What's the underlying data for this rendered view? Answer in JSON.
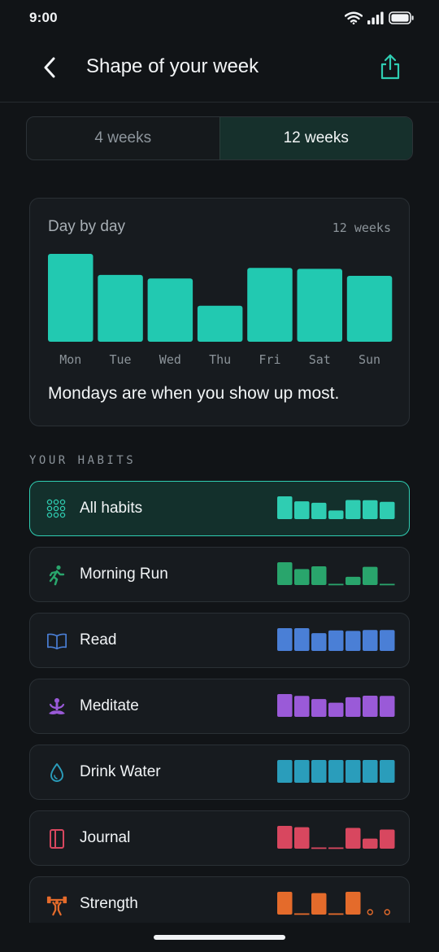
{
  "status": {
    "time": "9:00"
  },
  "header": {
    "title": "Shape of your week"
  },
  "range_toggle": {
    "options": [
      "4 weeks",
      "12 weeks"
    ],
    "selected": "12 weeks"
  },
  "day_card": {
    "title": "Day by day",
    "range_label": "12 weeks",
    "insight": "Mondays are when you show up most."
  },
  "chart_data": {
    "type": "bar",
    "categories": [
      "Mon",
      "Tue",
      "Wed",
      "Thu",
      "Fri",
      "Sat",
      "Sun"
    ],
    "values": [
      100,
      76,
      72,
      41,
      84,
      83,
      75
    ],
    "color": "#22c9b1"
  },
  "habits_section": {
    "label": "YOUR HABITS"
  },
  "habits": [
    {
      "name": "All habits",
      "icon": "grid-icon",
      "color": "#2fcdb2",
      "selected": true,
      "week": [
        100,
        78,
        72,
        38,
        84,
        83,
        76
      ]
    },
    {
      "name": "Morning Run",
      "icon": "running-icon",
      "color": "#29a56c",
      "week": [
        100,
        70,
        82,
        0,
        36,
        80,
        0
      ]
    },
    {
      "name": "Read",
      "icon": "book-icon",
      "color": "#4a7fd6",
      "week": [
        100,
        100,
        78,
        90,
        88,
        92,
        92
      ]
    },
    {
      "name": "Meditate",
      "icon": "meditation-icon",
      "color": "#9a5ad8",
      "week": [
        100,
        92,
        78,
        62,
        86,
        93,
        92
      ]
    },
    {
      "name": "Drink Water",
      "icon": "water-drop-icon",
      "color": "#2a9dbb",
      "week": [
        100,
        100,
        100,
        100,
        100,
        100,
        100
      ]
    },
    {
      "name": "Journal",
      "icon": "journal-icon",
      "color": "#d8475f",
      "week": [
        100,
        94,
        0,
        0,
        91,
        44,
        84
      ]
    },
    {
      "name": "Strength",
      "icon": "dumbbell-icon",
      "color": "#e46b2b",
      "week": [
        100,
        0,
        94,
        0,
        100,
        null,
        null
      ]
    }
  ]
}
